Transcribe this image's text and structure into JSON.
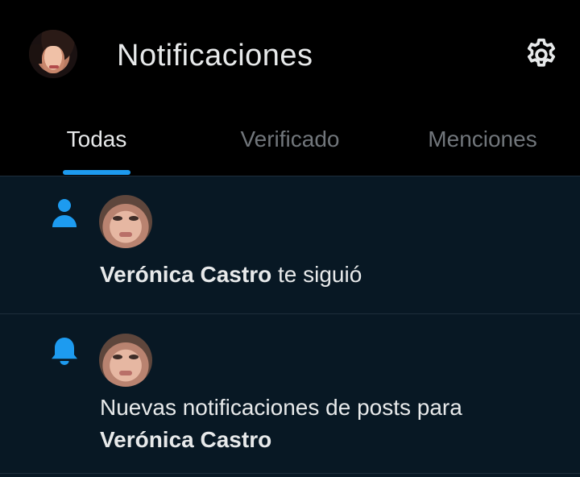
{
  "header": {
    "title": "Notificaciones",
    "settings_icon": "gear-icon",
    "avatar": "profile-avatar"
  },
  "tabs": [
    {
      "label": "Todas",
      "active": true
    },
    {
      "label": "Verificado",
      "active": false
    },
    {
      "label": "Menciones",
      "active": false
    }
  ],
  "notifications": [
    {
      "icon": "person-icon",
      "user": "Verónica Castro",
      "text": " te siguió"
    },
    {
      "icon": "bell-icon",
      "text_prefix": "Nuevas notificaciones de posts para",
      "user": "Verónica Castro"
    }
  ],
  "colors": {
    "background": "#000000",
    "list_background": "#081824",
    "accent": "#1d9bf0",
    "text": "#e7e9ea",
    "muted": "#71767b"
  }
}
